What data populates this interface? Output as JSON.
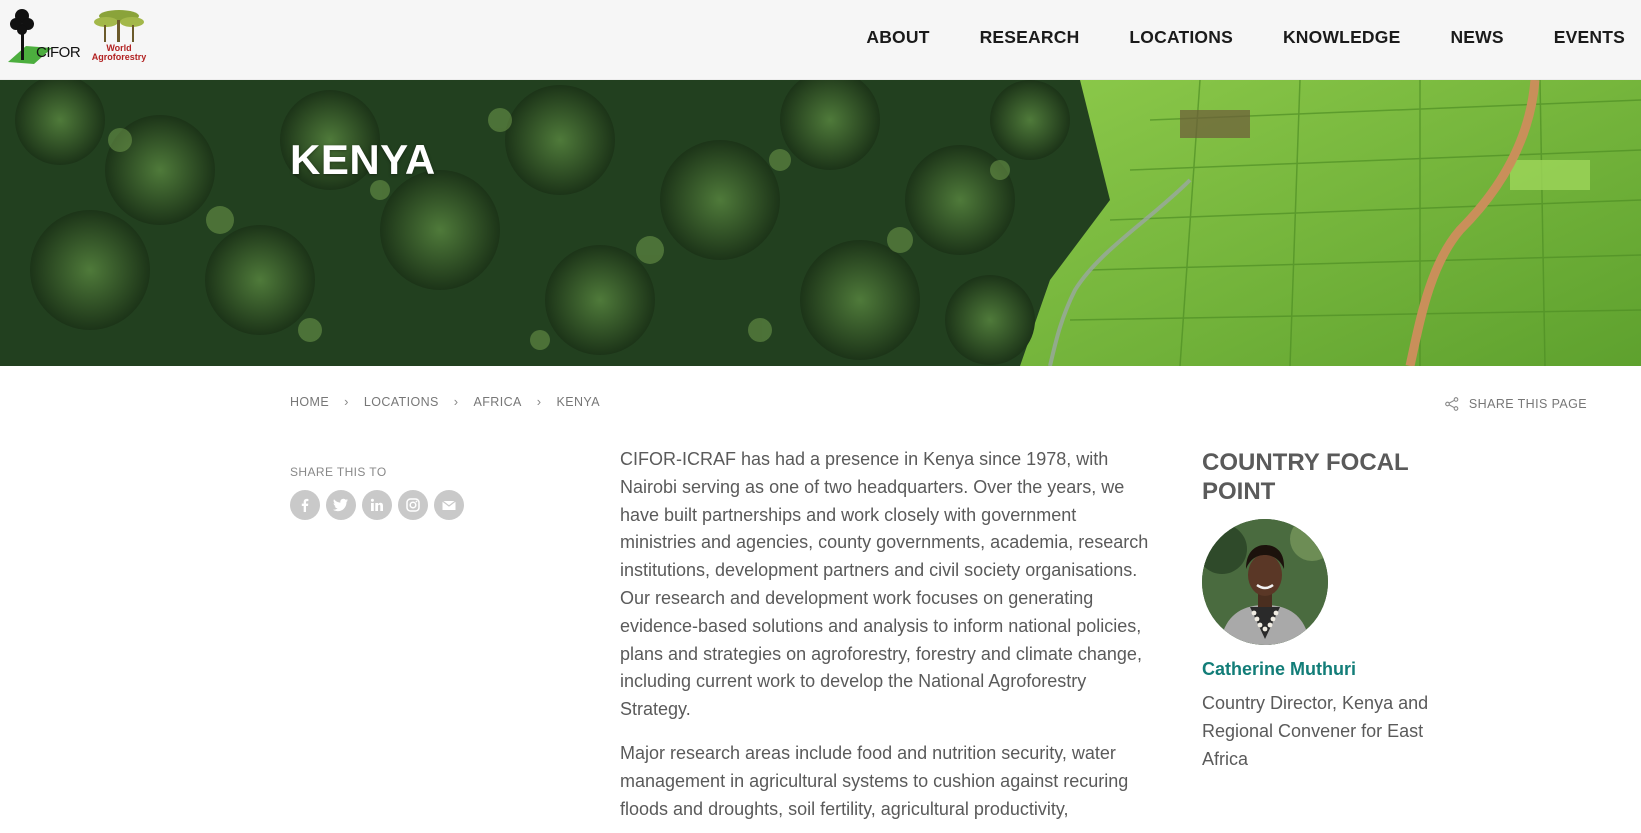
{
  "header": {
    "logos": {
      "cifor_text": "CIFOR",
      "world_agroforestry_text": [
        "World",
        "Agroforestry"
      ]
    },
    "nav": [
      {
        "label": "ABOUT"
      },
      {
        "label": "RESEARCH"
      },
      {
        "label": "LOCATIONS"
      },
      {
        "label": "KNOWLEDGE"
      },
      {
        "label": "NEWS"
      },
      {
        "label": "EVENTS"
      }
    ]
  },
  "hero": {
    "title": "KENYA"
  },
  "breadcrumb": {
    "items": [
      "HOME",
      "LOCATIONS",
      "AFRICA",
      "KENYA"
    ],
    "separator": "›"
  },
  "share_page": {
    "label": "SHARE THIS PAGE",
    "icon": "share-icon"
  },
  "share_to": {
    "label": "SHARE THIS TO",
    "icons": [
      "facebook-icon",
      "twitter-icon",
      "linkedin-icon",
      "instagram-icon",
      "email-icon"
    ]
  },
  "article": {
    "paragraphs": [
      "CIFOR-ICRAF has had a presence in Kenya since 1978, with Nairobi serving as one of two headquarters. Over the years, we have built partnerships and work closely with government ministries and agencies, county governments, academia, research institutions, development partners and civil society organisations. Our research and development work focuses on generating evidence-based solutions and analysis to inform national policies, plans and strategies on agroforestry, forestry and climate change, including current work to develop the National Agroforestry Strategy.",
      "Major research areas include food and nutrition security, water management in agricultural systems to cushion against recuring floods and droughts, soil fertility, agricultural productivity,"
    ]
  },
  "focal_point": {
    "heading": "COUNTRY FOCAL POINT",
    "name": "Catherine Muthuri",
    "role": "Country Director, Kenya and Regional Convener for East Africa"
  },
  "colors": {
    "header_bg": "#f6f6f6",
    "accent_teal": "#127d78",
    "text_gray": "#5a5a5a",
    "social_bg": "#c9c9c9",
    "forest_dark": "#1f3d1d",
    "field_green": "#7fbf3f"
  }
}
